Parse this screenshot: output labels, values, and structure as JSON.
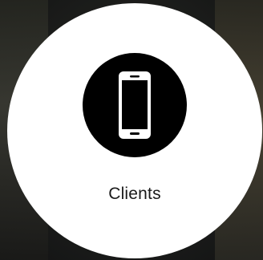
{
  "tile": {
    "label": "Clients",
    "icon": "smartphone-icon"
  },
  "colors": {
    "tile_bg": "#ffffff",
    "icon_bg": "#000000",
    "icon_fg": "#ffffff",
    "label": "#1a1a1a"
  }
}
